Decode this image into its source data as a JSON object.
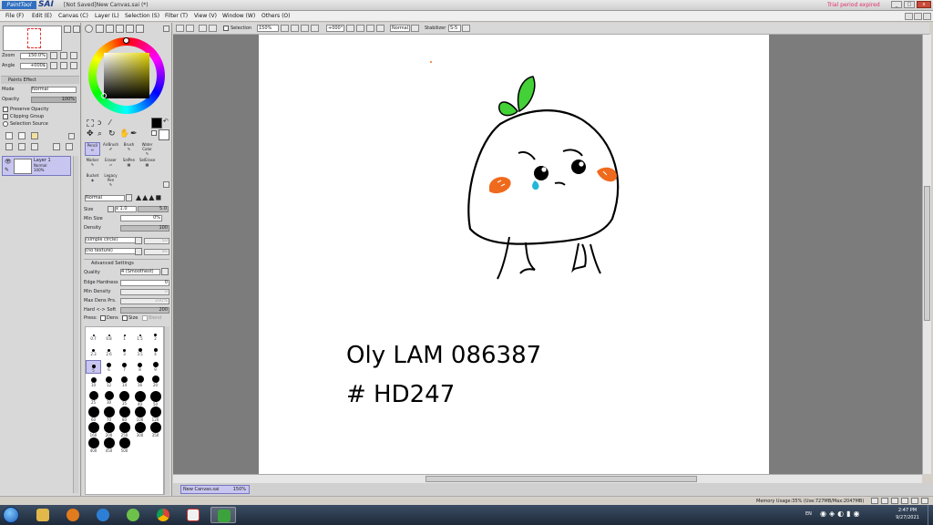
{
  "window": {
    "app_name_1": "PaintTool",
    "app_name_2": "SAI",
    "doc_title": "[Not Saved]New Canvas.sai (*)",
    "trial_notice": "Trial period expired",
    "btn_min": "_",
    "btn_max": "□",
    "btn_close": "x"
  },
  "menu": [
    "File (F)",
    "Edit (E)",
    "Canvas (C)",
    "Layer (L)",
    "Selection (S)",
    "Filter (T)",
    "View (V)",
    "Window (W)",
    "Others (O)"
  ],
  "navigator": {
    "zoom_label": "Zoom",
    "zoom_value": "150.0%",
    "angle_label": "Angle",
    "angle_value": "+000$"
  },
  "layer_panel": {
    "section_title": "Paints Effect",
    "mode_label": "Mode",
    "mode_value": "Normal",
    "opacity_label": "Opacity",
    "opacity_value": "100%",
    "preserve_opacity": "Preserve Opacity",
    "clipping_group": "Clipping Group",
    "selection_source": "Selection Source",
    "layer_name": "Layer 1",
    "layer_mode": "Normal",
    "layer_opacity": "100%"
  },
  "tools": {
    "row1": [
      "Pencil",
      "AirBrush",
      "Brush",
      "Water Color"
    ],
    "row2": [
      "Marker",
      "Eraser",
      "SelPen",
      "SelErase"
    ],
    "row3": [
      "Bucket",
      "Legacy Pen"
    ],
    "blend_mode": "Normal",
    "size_label": "Size",
    "size_mult": "x 1.0",
    "size_value": "5.0",
    "min_size_label": "Min Size",
    "min_size_value": "0%",
    "density_label": "Density",
    "density_value": "100",
    "shape": "(simple circle)",
    "shape_value": "50",
    "texture": "(no texture)",
    "texture_value": "95",
    "advanced_title": "Advanced Settings",
    "quality_label": "Quality",
    "quality_value": "4 (Smoothest)",
    "edge_label": "Edge Hardness",
    "edge_value": "0",
    "min_density_label": "Min Density",
    "min_density_value": "0",
    "max_dens_label": "Max Dens Prs.",
    "max_dens_value": "100%",
    "hard_soft_label": "Hard <-> Soft",
    "hard_soft_value": "200",
    "press_label": "Press:",
    "press_dens": "Dens",
    "press_size": "Size",
    "press_blend": "Blend"
  },
  "brush_sizes": [
    "0.7",
    "0.8",
    "1",
    "1.5",
    "2",
    "2.3",
    "2.6",
    "3",
    "3.5",
    "4",
    "5",
    "6",
    "7",
    "8",
    "9",
    "10",
    "12",
    "14",
    "16",
    "20",
    "25",
    "30",
    "35",
    "40",
    "50",
    "60",
    "70",
    "80",
    "100",
    "120",
    "160",
    "200",
    "250",
    "300",
    "350",
    "400",
    "450",
    "500"
  ],
  "canvas_toolbar": {
    "selection_label": "Selection",
    "zoom": "150%",
    "angle": "+000°",
    "mode": "Normal",
    "stabilizer_label": "Stabilizer",
    "stabilizer_value": "S-5"
  },
  "canvas_text": {
    "line1": "Oly LAM 086387",
    "line2": "# HD247"
  },
  "doc_tab": {
    "name": "New Canvas.sai",
    "zoom": "150%"
  },
  "status": {
    "memory": "Memory Usage:35% (Use:727MB/Max:2047MB)",
    "lang": "EN",
    "time": "2:47 PM",
    "date": "9/27/2021"
  },
  "colors": {
    "accent": "#c8c6f0",
    "sprout": "#43d137",
    "blush": "#ef6a1c",
    "tear": "#23b6d9"
  },
  "taskbar_apps": [
    "start-orb",
    "windows-explorer",
    "media-player",
    "internet-explorer",
    "itunes",
    "chrome",
    "paint-app",
    "paint-tool-sai"
  ]
}
